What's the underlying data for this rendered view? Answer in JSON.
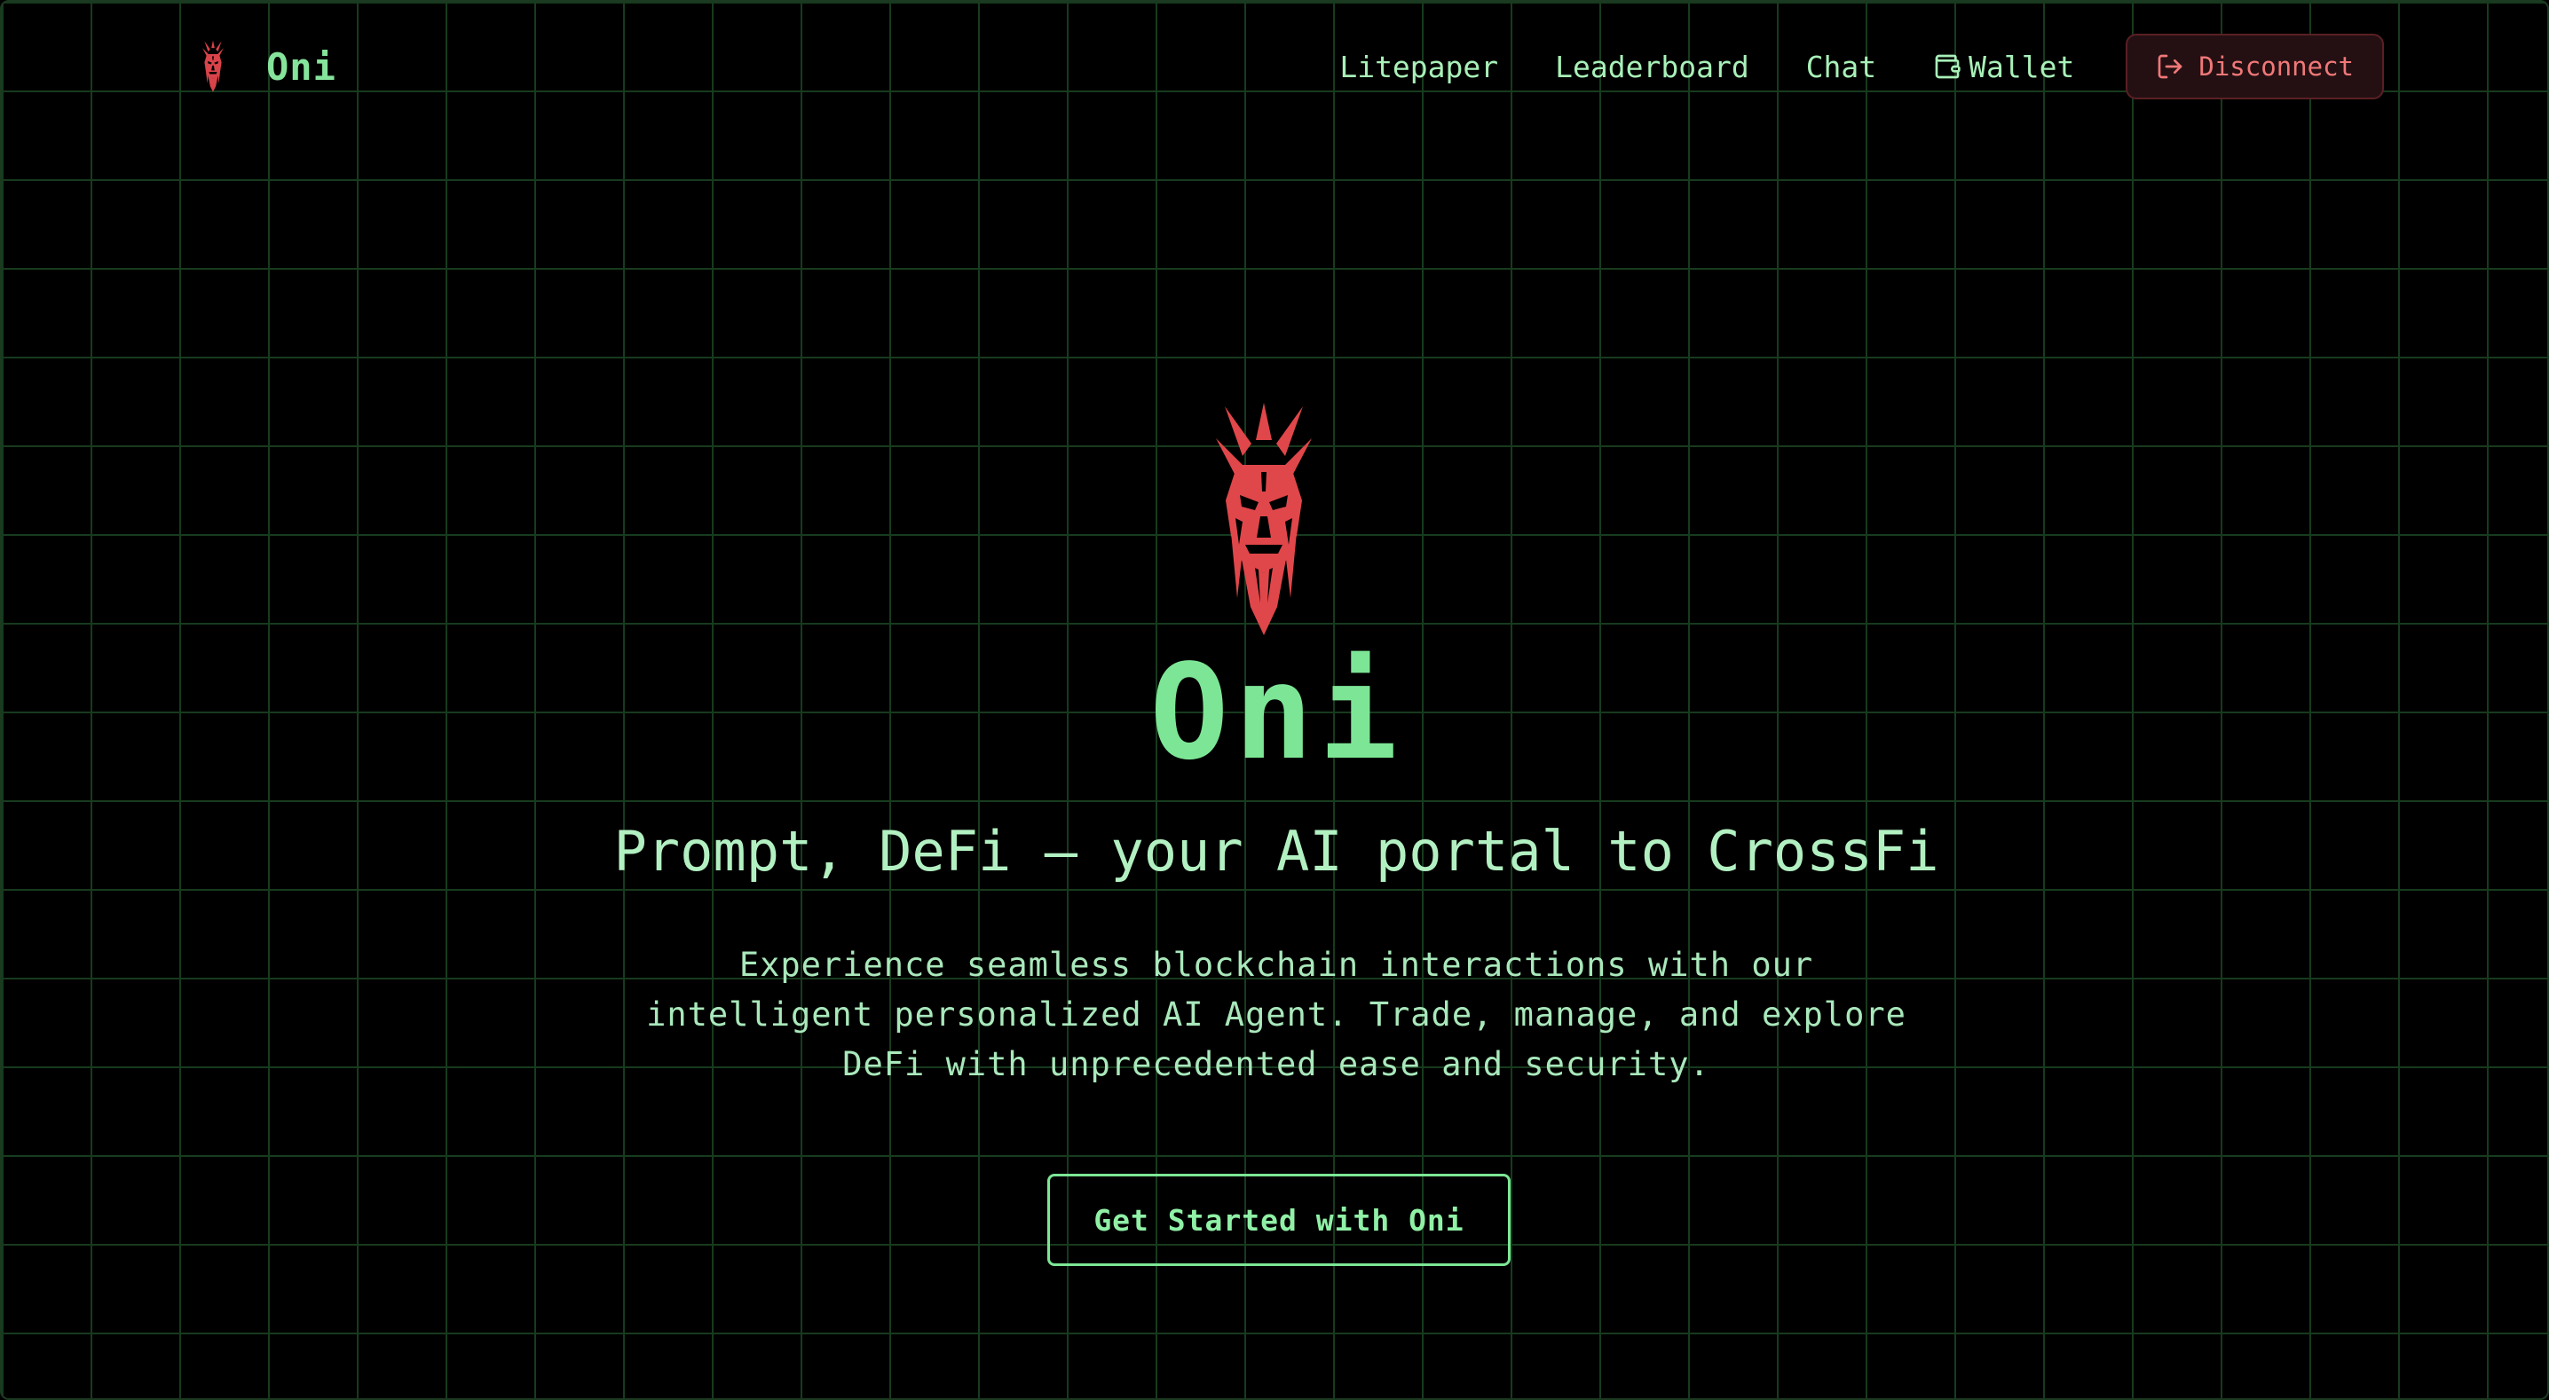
{
  "header": {
    "brand_name": "Oni",
    "brand_logo_icon": "oni-mask-icon",
    "nav": {
      "litepaper": "Litepaper",
      "leaderboard": "Leaderboard",
      "chat": "Chat",
      "wallet": "Wallet",
      "wallet_icon": "wallet-icon"
    },
    "disconnect_label": "Disconnect",
    "disconnect_icon": "logout-icon"
  },
  "hero": {
    "logo_icon": "oni-mask-icon",
    "title": "Oni",
    "subtitle": "Prompt, DeFi — your AI portal to CrossFi",
    "description": "Experience seamless blockchain interactions with our intelligent personalized AI Agent. Trade, manage, and explore DeFi with unprecedented ease and security.",
    "cta_label": "Get Started with Oni"
  },
  "colors": {
    "background": "#000000",
    "grid": "#173b1e",
    "accent_green": "#7de696",
    "text_green": "#a8f0b8",
    "mask_red": "#e0474a",
    "disconnect_text": "#f07878",
    "disconnect_bg": "#241013"
  }
}
